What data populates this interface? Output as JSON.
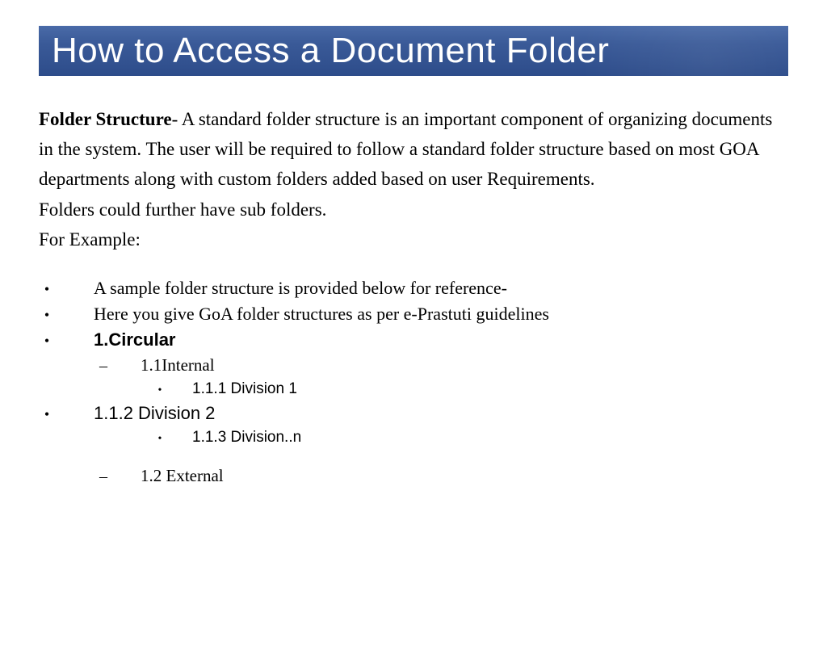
{
  "title": "How to Access a Document Folder",
  "paragraph": {
    "lead_bold": "Folder Structure",
    "body_after_lead": "- A standard folder structure is an important component of organizing documents in the system. The user will be required to follow a standard folder structure based on most GOA departments  along with custom folders added based on user Requirements.",
    "line2": "Folders could further have sub folders.",
    "line3": "For Example:"
  },
  "bullets": {
    "item1": "A sample folder structure is provided below for reference-",
    "item2": "Here you give GoA folder structures as per e-Prastuti guidelines",
    "item3": "1.Circular",
    "item3_1": "1.1Internal",
    "item3_1_1": "1.1.1 Division 1",
    "item4": "1.1.2 Division 2",
    "item4_1": "1.1.3 Division..n",
    "item5": "1.2 External"
  }
}
